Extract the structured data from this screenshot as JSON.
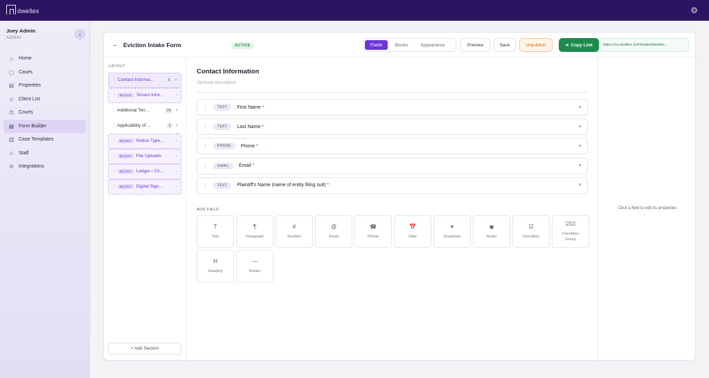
{
  "brand": {
    "name": "dwellex"
  },
  "user": {
    "name": "Joey Admin",
    "role": "ADMIN"
  },
  "nav": [
    {
      "label": "Home",
      "icon": "home-icon",
      "glyph": "⌂"
    },
    {
      "label": "Cases",
      "icon": "briefcase-icon",
      "glyph": "▢"
    },
    {
      "label": "Properties",
      "icon": "building-icon",
      "glyph": "▤"
    },
    {
      "label": "Client List",
      "icon": "users-icon",
      "glyph": "☺"
    },
    {
      "label": "Courts",
      "icon": "scale-icon",
      "glyph": "⚖"
    },
    {
      "label": "Form Builder",
      "icon": "form-icon",
      "glyph": "▦",
      "active": true
    },
    {
      "label": "Case Templates",
      "icon": "template-icon",
      "glyph": "▥"
    },
    {
      "label": "Staff",
      "icon": "staff-icon",
      "glyph": "☺"
    },
    {
      "label": "Integrations",
      "icon": "link-icon",
      "glyph": "⊖"
    }
  ],
  "header": {
    "title": "Eviction Intake Form",
    "status": "ACTIVE",
    "tabs": [
      "Fields",
      "Blocks",
      "Appearance"
    ],
    "active_tab": "Fields",
    "preview_label": "Preview",
    "save_label": "Save",
    "unpublish_label": "Unpublish",
    "copy_link_label": "Copy Link",
    "url": "https://os.dwellex.io/#/intake/dwellex..."
  },
  "layout": {
    "label": "LAYOUT",
    "block_tag": "BLOCK",
    "sections": [
      {
        "title": "Contact Informa...",
        "count": "5",
        "type": "section",
        "selected": true
      },
      {
        "title": "Tenant Infor...",
        "type": "block"
      },
      {
        "title": "Additional Ten...",
        "count": "24",
        "type": "section"
      },
      {
        "title": "Applicability of ...",
        "count": "2",
        "type": "section"
      },
      {
        "title": "Notice Type...",
        "type": "block"
      },
      {
        "title": "File Uploads",
        "type": "block"
      },
      {
        "title": "Ledger / Ch...",
        "type": "block"
      },
      {
        "title": "Digital Sign...",
        "type": "block"
      }
    ],
    "add_section_label": "+ Add Section"
  },
  "main": {
    "section_title": "Contact Information",
    "section_description": "Optional description",
    "fields": [
      {
        "type": "TEXT",
        "label": "First Name",
        "required": "*"
      },
      {
        "type": "TEXT",
        "label": "Last Name",
        "required": "*"
      },
      {
        "type": "PHONE",
        "label": "Phone",
        "required": "*"
      },
      {
        "type": "EMAIL",
        "label": "Email",
        "required": "*"
      },
      {
        "type": "TEXT",
        "label": "Plaintiff's Name (name of entity filing suit)",
        "required": "*"
      }
    ],
    "add_field_label": "ADD FIELD",
    "field_types": [
      {
        "label": "Text",
        "icon": "text-icon",
        "glyph": "T"
      },
      {
        "label": "Paragraph",
        "icon": "paragraph-icon",
        "glyph": "¶"
      },
      {
        "label": "Number",
        "icon": "hash-icon",
        "glyph": "#"
      },
      {
        "label": "Email",
        "icon": "at-icon",
        "glyph": "@"
      },
      {
        "label": "Phone",
        "icon": "phone-icon",
        "glyph": "☎"
      },
      {
        "label": "Date",
        "icon": "calendar-icon",
        "glyph": "📅"
      },
      {
        "label": "Dropdown",
        "icon": "dropdown-icon",
        "glyph": "▾"
      },
      {
        "label": "Radio",
        "icon": "radio-icon",
        "glyph": "◉"
      },
      {
        "label": "Checkbox",
        "icon": "checkbox-icon",
        "glyph": "☑"
      },
      {
        "label": "Checkbox Group",
        "icon": "checkbox-group-icon",
        "glyph": "☑☑"
      },
      {
        "label": "Heading",
        "icon": "heading-icon",
        "glyph": "H"
      },
      {
        "label": "Divider",
        "icon": "divider-icon",
        "glyph": "—"
      }
    ]
  },
  "properties": {
    "hint": "Click a field to edit its properties"
  },
  "colors": {
    "accent": "#6d35d6",
    "topbar": "#2d1460",
    "success": "#1e8b4e",
    "warning": "#c46b12"
  }
}
